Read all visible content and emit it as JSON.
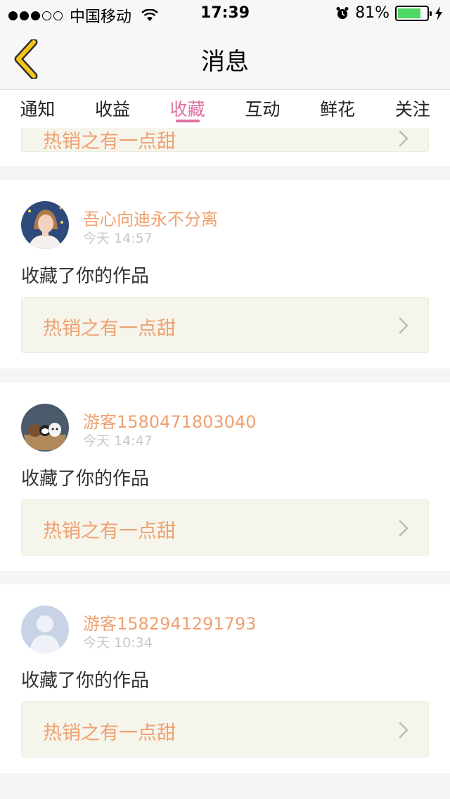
{
  "status_bar": {
    "carrier": "中国移动",
    "time": "17:39",
    "battery": "81%",
    "battery_level": 0.81
  },
  "nav": {
    "title": "消息"
  },
  "tabs": [
    {
      "label": "通知",
      "active": false
    },
    {
      "label": "收益",
      "active": false
    },
    {
      "label": "收藏",
      "active": true
    },
    {
      "label": "互动",
      "active": false
    },
    {
      "label": "鲜花",
      "active": false
    },
    {
      "label": "关注",
      "active": false
    }
  ],
  "partial_item": {
    "work_title": "热销之有一点甜"
  },
  "items": [
    {
      "username": "吾心向迪永不分离",
      "time": "今天 14:57",
      "action": "收藏了你的作品",
      "work_title": "热销之有一点甜",
      "avatar": "photo-avatar-icon"
    },
    {
      "username": "游客1580471803040",
      "time": "今天 14:47",
      "action": "收藏了你的作品",
      "work_title": "热销之有一点甜",
      "avatar": "bears-avatar-icon"
    },
    {
      "username": "游客1582941291793",
      "time": "今天 10:34",
      "action": "收藏了你的作品",
      "work_title": "热销之有一点甜",
      "avatar": "default-avatar-icon"
    }
  ],
  "colors": {
    "accent": "#e06fa3",
    "username": "#f0a070",
    "work_bg": "#f6f5ec",
    "back_arrow": "#f5c518"
  }
}
